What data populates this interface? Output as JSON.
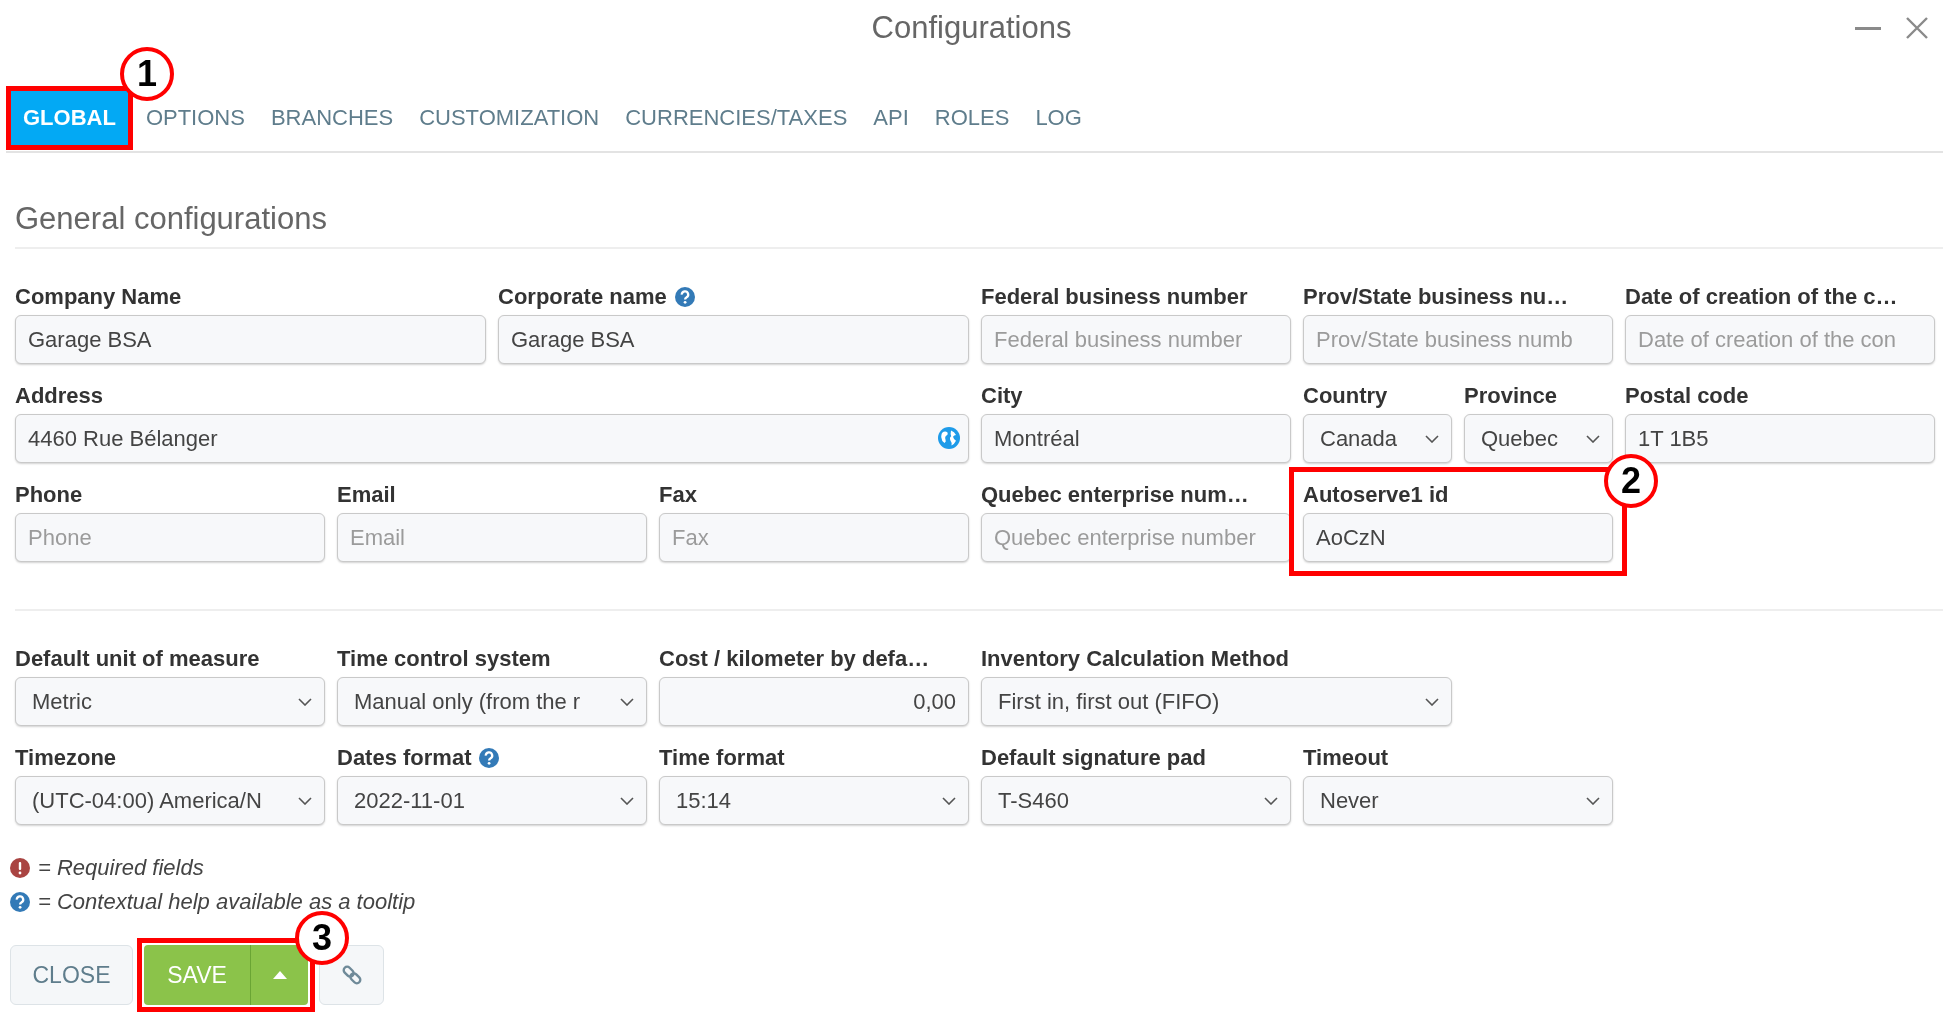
{
  "window": {
    "title": "Configurations"
  },
  "tabs": [
    {
      "label": "GLOBAL",
      "selected": true,
      "callout": "1"
    },
    {
      "label": "OPTIONS",
      "selected": false
    },
    {
      "label": "BRANCHES",
      "selected": false
    },
    {
      "label": "CUSTOMIZATION",
      "selected": false
    },
    {
      "label": "CURRENCIES/TAXES",
      "selected": false
    },
    {
      "label": "API",
      "selected": false
    },
    {
      "label": "ROLES",
      "selected": false
    },
    {
      "label": "LOG",
      "selected": false
    }
  ],
  "section": {
    "title": "General configurations"
  },
  "field_groups": [
    {
      "rows": [
        [
          {
            "label": "Company Name",
            "kind": "text",
            "help": false,
            "value": "Garage BSA"
          },
          {
            "label": "Corporate name",
            "kind": "text",
            "help": true,
            "value": "Garage BSA"
          },
          {
            "label": "Federal business number",
            "kind": "text",
            "help": false,
            "placeholder": "Federal business number"
          },
          {
            "label": "Prov/State business nu…",
            "kind": "text",
            "help": false,
            "placeholder": "Prov/State business numb"
          },
          {
            "label": "Date of creation of the c…",
            "kind": "text",
            "help": false,
            "placeholder": "Date of creation of the con"
          }
        ],
        [
          {
            "label": "Address",
            "kind": "address",
            "help": false,
            "value": "4460 Rue Bélanger"
          },
          {
            "label": "City",
            "kind": "text",
            "help": false,
            "value": "Montréal"
          },
          {
            "label": "Country",
            "kind": "select",
            "help": false,
            "value": "Canada"
          },
          {
            "label": "Province",
            "kind": "select",
            "help": false,
            "value": "Quebec"
          },
          {
            "label": "Postal code",
            "kind": "text",
            "help": false,
            "value": "1T 1B5"
          }
        ],
        [
          {
            "label": "Phone",
            "kind": "text",
            "help": false,
            "placeholder": "Phone"
          },
          {
            "label": "Email",
            "kind": "text",
            "help": false,
            "placeholder": "Email"
          },
          {
            "label": "Fax",
            "kind": "text",
            "help": false,
            "placeholder": "Fax"
          },
          {
            "label": "Quebec enterprise num…",
            "kind": "text",
            "help": false,
            "placeholder": "Quebec enterprise number"
          },
          {
            "label": "Autoserve1 id",
            "kind": "text",
            "help": false,
            "value": "AoCzN",
            "callout": "2"
          }
        ]
      ]
    },
    {
      "rows": [
        [
          {
            "label": "Default unit of measure",
            "kind": "select",
            "help": false,
            "value": "Metric"
          },
          {
            "label": "Time control system",
            "kind": "select",
            "help": false,
            "value": "Manual only (from the r"
          },
          {
            "label": "Cost / kilometer by defa…",
            "kind": "number",
            "help": false,
            "value": "0,00"
          },
          {
            "label": "Inventory Calculation Method",
            "kind": "select",
            "help": false,
            "value": "First in, first out (FIFO)"
          }
        ],
        [
          {
            "label": "Timezone",
            "kind": "select",
            "help": false,
            "value": "(UTC-04:00) America/N"
          },
          {
            "label": "Dates format",
            "kind": "select",
            "help": true,
            "value": "2022-11-01"
          },
          {
            "label": "Time format",
            "kind": "select",
            "help": false,
            "value": "15:14"
          },
          {
            "label": "Default signature pad",
            "kind": "select",
            "help": false,
            "value": "T-S460"
          },
          {
            "label": "Timeout",
            "kind": "select",
            "help": false,
            "value": "Never"
          }
        ]
      ]
    }
  ],
  "legend": [
    {
      "kind": "required",
      "text": "= Required fields"
    },
    {
      "kind": "help",
      "text": "= Contextual help available as a tooltip"
    }
  ],
  "buttons": [
    {
      "kind": "plain",
      "label": "CLOSE"
    },
    {
      "kind": "split",
      "label": "SAVE",
      "callout": "3"
    },
    {
      "kind": "icon"
    }
  ]
}
